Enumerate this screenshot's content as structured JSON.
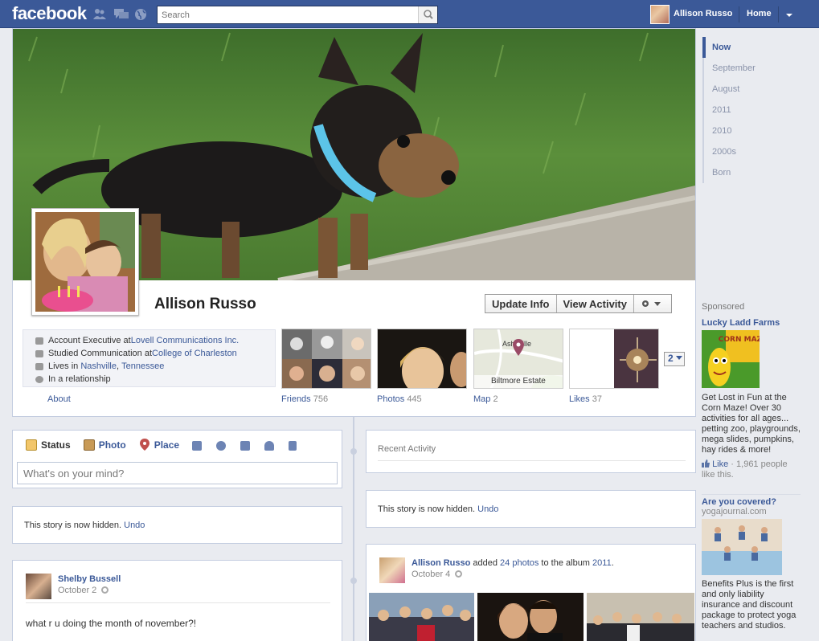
{
  "topbar": {
    "logo": "facebook",
    "search_placeholder": "Search",
    "user_name": "Allison Russo",
    "home_label": "Home"
  },
  "profile": {
    "name": "Allison Russo",
    "update_info": "Update Info",
    "view_activity": "View Activity",
    "about": [
      {
        "prefix": "Account Executive at ",
        "link": "Lovell Communications Inc.",
        "suffix": "",
        "icon": "briefcase-icon"
      },
      {
        "prefix": "Studied Communication at ",
        "link": "College of Charleston",
        "suffix": "",
        "icon": "graduation-icon"
      },
      {
        "prefix": "Lives in ",
        "link": "Nashville",
        "mid": ", ",
        "link2": "Tennessee",
        "icon": "house-icon"
      },
      {
        "prefix": "In a relationship",
        "link": "",
        "suffix": "",
        "icon": "heart-icon"
      }
    ],
    "about_label": "About",
    "tiles": {
      "friends": {
        "label": "Friends",
        "count": "756"
      },
      "photos": {
        "label": "Photos",
        "count": "445"
      },
      "map": {
        "label": "Map",
        "count": "2",
        "place": "Biltmore Estate",
        "city": "Asheville"
      },
      "likes": {
        "label": "Likes",
        "count": "37"
      }
    },
    "more_count": "2"
  },
  "timeline_nav": [
    "Now",
    "September",
    "August",
    "2011",
    "2010",
    "2000s",
    "Born"
  ],
  "sidebar": {
    "sponsored": "Sponsored",
    "ad1": {
      "title": "Lucky Ladd Farms",
      "image_text": "CORN MAZE",
      "body": "Get Lost in Fun at the Corn Maze! Over 30 activities for all ages... petting zoo, playgrounds, mega slides, pumpkins, hay rides & more!",
      "like": "Like",
      "like_count": " · 1,961 people like this."
    },
    "ad2": {
      "title": "Are you covered?",
      "domain": "yogajournal.com",
      "body": "Benefits Plus is the first and only liability insurance and discount package to protect yoga teachers and studios."
    }
  },
  "composer": {
    "status": "Status",
    "photo": "Photo",
    "place": "Place",
    "placeholder": "What's on your mind?"
  },
  "recent_activity": "Recent Activity",
  "hidden_story": {
    "text": "This story is now hidden.",
    "undo": "Undo"
  },
  "post_left": {
    "author": "Shelby Bussell",
    "date": "October 2",
    "text": "what r u doing the month of november?!"
  },
  "post_right": {
    "author": "Allison Russo",
    "action_1": " added ",
    "photos_link": "24 photos",
    "action_2": " to the album ",
    "album_link": "2011",
    "period": ".",
    "date": "October 4"
  },
  "colors": {
    "brand": "#3b5998",
    "background": "#e9ebf0",
    "link": "#3b5998"
  }
}
